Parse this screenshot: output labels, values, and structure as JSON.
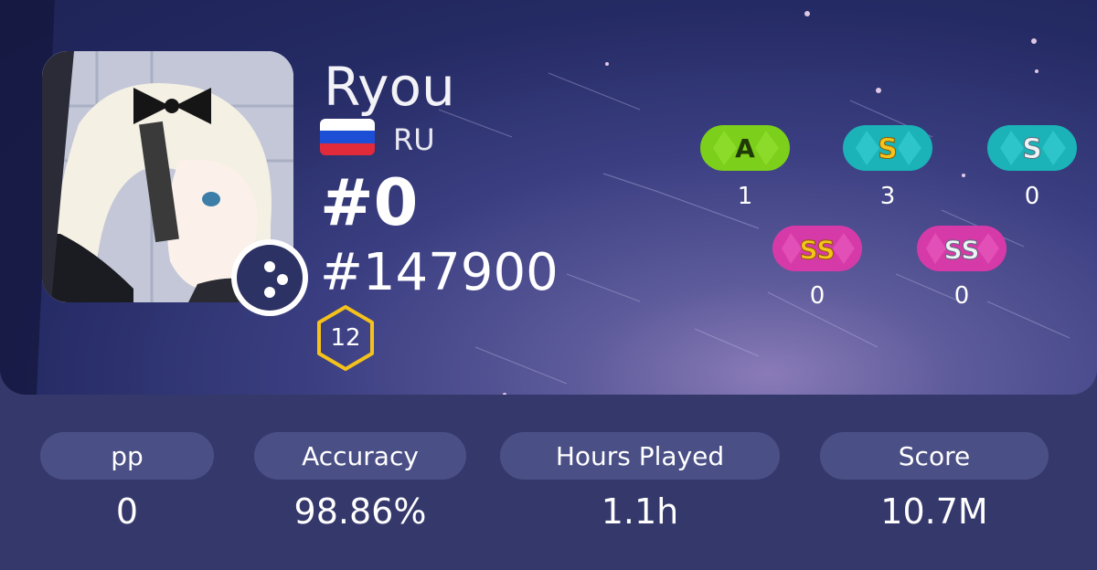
{
  "profile": {
    "username": "Ryou",
    "country_code": "RU",
    "global_rank": "#0",
    "country_rank": "#147900",
    "level": "12"
  },
  "grades": [
    {
      "label": "A",
      "count": "1"
    },
    {
      "label": "S",
      "count": "3"
    },
    {
      "label": "S",
      "count": "0"
    },
    {
      "label": "SS",
      "count": "0"
    },
    {
      "label": "SS",
      "count": "0"
    }
  ],
  "stats": [
    {
      "label": "pp",
      "value": "0"
    },
    {
      "label": "Accuracy",
      "value": "98.86%"
    },
    {
      "label": "Hours Played",
      "value": "1.1h"
    },
    {
      "label": "Score",
      "value": "10.7M"
    }
  ],
  "colors": {
    "page_bg": "#35386b",
    "pill_bg": "#4a4f86",
    "grade_a": "#7ccf1a",
    "grade_s": "#1bb3b8",
    "grade_ss": "#d63aa8",
    "level_ring": "#f5c21b"
  },
  "icons": {
    "mode": "osu-catch-icon",
    "level": "hexagon-level-icon",
    "flag": "russia-flag-icon"
  }
}
